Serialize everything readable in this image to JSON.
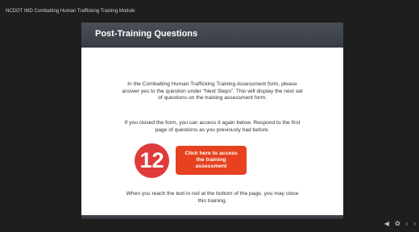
{
  "player": {
    "title": "NCDOT IMD Combatting Human Trafficking Training Module"
  },
  "slide": {
    "title": "Post-Training Questions",
    "paragraph1": "In the Combatting Human Trafficking Training Assessment form, please answer yes to the question under \"Next Steps\". This will display the next set of questions on the training assessment form.",
    "paragraph2": "If you closed the form, you can access it again below. Respond to the first page of questions as you previously had before.",
    "step_number": "12",
    "button_label": "Click here to access the training assessment",
    "paragraph3": "When you reach the text in red at the bottom of the page, you may close this training."
  },
  "controls": {
    "volume_icon": "◀",
    "settings_icon": "✿",
    "prev_icon": "‹",
    "next_icon": "›"
  },
  "colors": {
    "accent": "#e6421f",
    "badge": "#e03b3b",
    "header": "#42464d"
  }
}
